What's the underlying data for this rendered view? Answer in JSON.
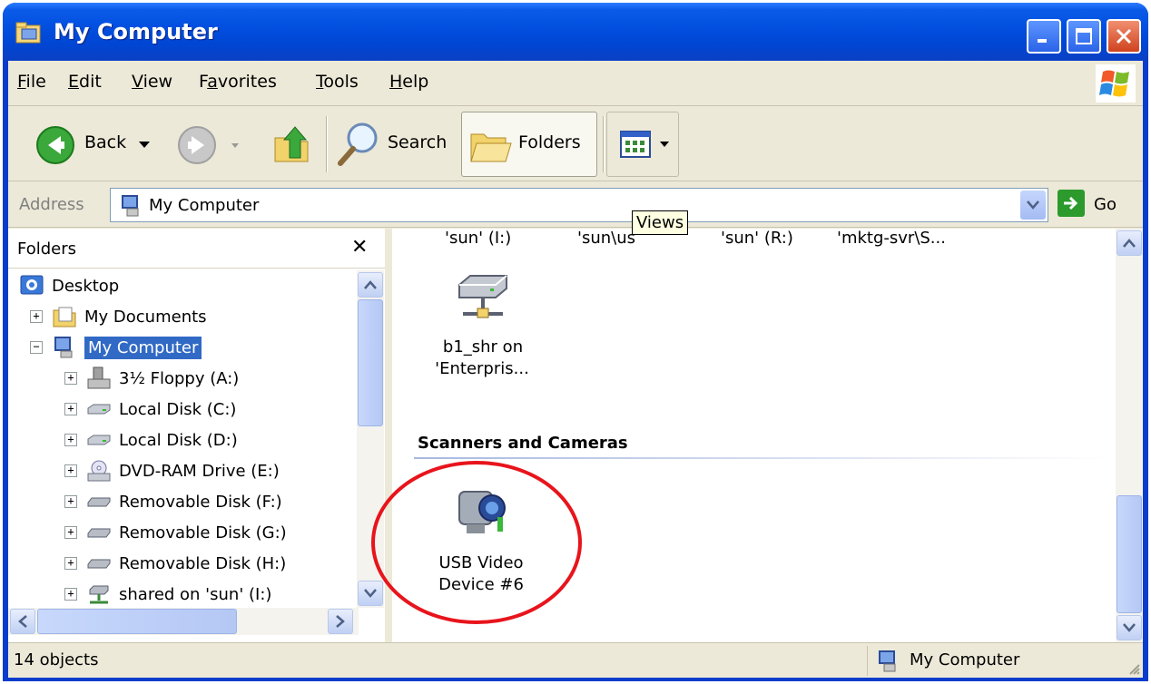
{
  "window": {
    "title": "My Computer"
  },
  "menu": {
    "items": [
      {
        "label": "File",
        "accel": "F",
        "rest": "ile"
      },
      {
        "label": "Edit",
        "accel": "E",
        "rest": "dit"
      },
      {
        "label": "View",
        "accel": "V",
        "rest": "iew"
      },
      {
        "label": "Favorites",
        "accel": "a",
        "pre": "F",
        "rest": "vorites"
      },
      {
        "label": "Tools",
        "accel": "T",
        "rest": "ools"
      },
      {
        "label": "Help",
        "accel": "H",
        "rest": "elp"
      }
    ]
  },
  "toolbar": {
    "back_label": "Back",
    "search_label": "Search",
    "folders_label": "Folders"
  },
  "address": {
    "label": "Address",
    "value": "My Computer",
    "go_label": "Go"
  },
  "tooltip": "Views",
  "folders_pane": {
    "title": "Folders",
    "tree": [
      {
        "label": "Desktop",
        "icon": "desktop-icon",
        "expander": ""
      },
      {
        "label": "My Documents",
        "icon": "my-documents-icon",
        "expander": "+"
      },
      {
        "label": "My Computer",
        "icon": "my-computer-icon",
        "expander": "−"
      },
      {
        "label": "3½ Floppy (A:)",
        "icon": "floppy-icon",
        "expander": "+"
      },
      {
        "label": "Local Disk (C:)",
        "icon": "hard-disk-icon",
        "expander": "+"
      },
      {
        "label": "Local Disk (D:)",
        "icon": "hard-disk-icon",
        "expander": "+"
      },
      {
        "label": "DVD-RAM Drive (E:)",
        "icon": "dvd-drive-icon",
        "expander": "+"
      },
      {
        "label": "Removable Disk (F:)",
        "icon": "removable-disk-icon",
        "expander": "+"
      },
      {
        "label": "Removable Disk (G:)",
        "icon": "removable-disk-icon",
        "expander": "+"
      },
      {
        "label": "Removable Disk (H:)",
        "icon": "removable-disk-icon",
        "expander": "+"
      },
      {
        "label": "shared on 'sun' (I:)",
        "icon": "network-drive-icon",
        "expander": "+"
      }
    ]
  },
  "content": {
    "top_row_labels": [
      "'sun' (I:)",
      "'sun\\us",
      "'sun' (R:)",
      "'mktg-svr\\S..."
    ],
    "network_item": {
      "line1": "b1_shr on",
      "line2": "'Enterpris..."
    },
    "group_title": "Scanners and Cameras",
    "camera_item": {
      "line1": "USB Video",
      "line2": "Device #6"
    }
  },
  "status": {
    "left": "14 objects",
    "right": "My Computer"
  }
}
